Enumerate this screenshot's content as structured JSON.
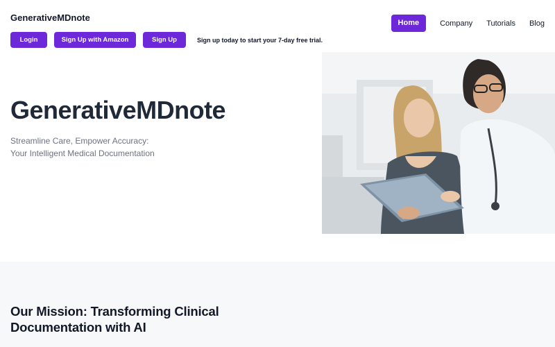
{
  "header": {
    "brand": "GenerativeMDnote",
    "nav": [
      {
        "label": "Home",
        "active": true
      },
      {
        "label": "Company",
        "active": false
      },
      {
        "label": "Tutorials",
        "active": false
      },
      {
        "label": "Blog",
        "active": false
      }
    ]
  },
  "auth": {
    "login_label": "Login",
    "amazon_label": "Sign Up with Amazon",
    "signup_label": "Sign Up",
    "trial_text": "Sign up today to start your 7-day free trial."
  },
  "hero": {
    "title": "GenerativeMDnote",
    "tagline": "Streamline Care, Empower Accuracy: Your Intelligent Medical Documentation",
    "image_alt": "doctor-and-patient-with-tablet-photo"
  },
  "mission": {
    "title": "Our Mission: Transforming Clinical Documentation with AI"
  },
  "colors": {
    "accent": "#6d28d9",
    "section_bg": "#f7f8fa"
  }
}
